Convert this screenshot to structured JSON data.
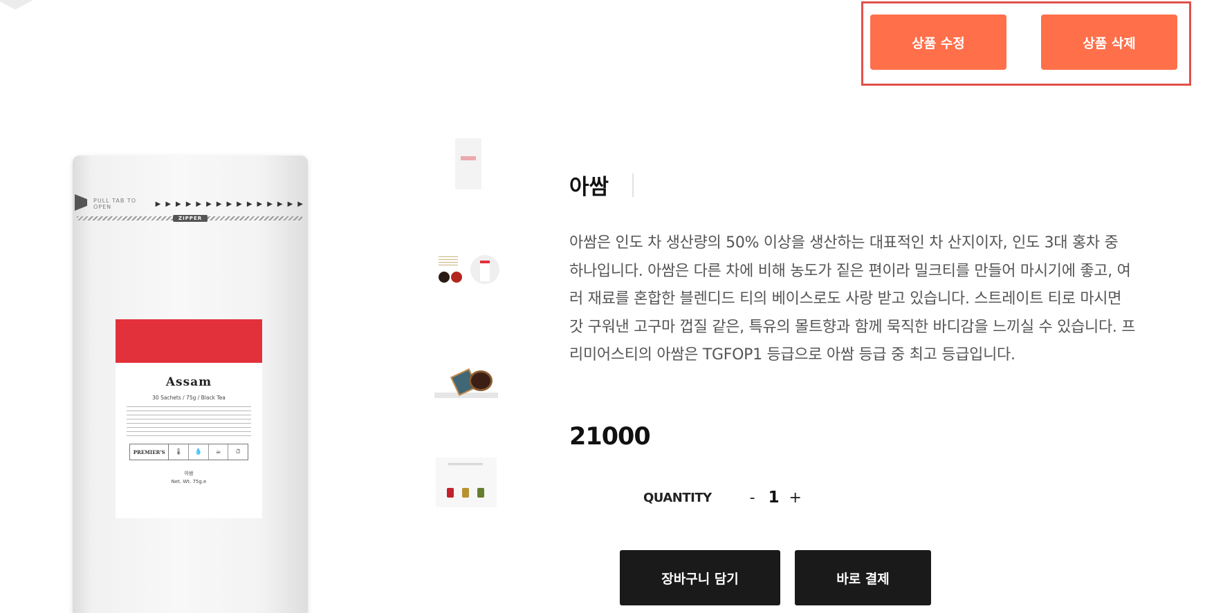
{
  "admin": {
    "edit_label": "상품 수정",
    "delete_label": "상품 삭제",
    "button_color": "#ff6f4a",
    "highlight_border_color": "#e0504a"
  },
  "gallery": {
    "main_image": {
      "tear_text": "PULL TAB TO OPEN",
      "zipper_text": "ZIPPER",
      "label_name": "Assam",
      "label_sub": "30 Sachets / 75g / Black Tea",
      "label_brand": "PREMIER'S",
      "label_korean_name": "아쌈",
      "label_weight": "Net. Wt. 75g.e"
    },
    "thumbnails": [
      "product-front-thumbnail",
      "tea-leaves-thumbnail",
      "tea-sachet-cup-thumbnail",
      "tea-lineup-thumbnail"
    ]
  },
  "product": {
    "name": "아쌈",
    "description": "아쌈은 인도 차 생산량의 50% 이상을 생산하는 대표적인 차 산지이자, 인도 3대 홍차 중 하나입니다. 아쌈은 다른 차에 비해 농도가 짙은 편이라 밀크티를 만들어 마시기에 좋고, 여러 재료를 혼합한 블렌디드 티의 베이스로도 사랑 받고 있습니다. 스트레이트 티로 마시면 갓 구워낸 고구마 껍질 같은, 특유의 몰트향과 함께 묵직한 바디감을 느끼실 수 있습니다. 프리미어스티의 아쌈은 TGFOP1 등급으로 아쌈 등급 중 최고 등급입니다.",
    "price": "21000"
  },
  "quantity": {
    "label": "QUANTITY",
    "minus": "-",
    "value": "1",
    "plus": "+"
  },
  "actions": {
    "cart_label": "장바구니 담기",
    "checkout_label": "바로 결제",
    "button_color": "#1a1a1a"
  }
}
